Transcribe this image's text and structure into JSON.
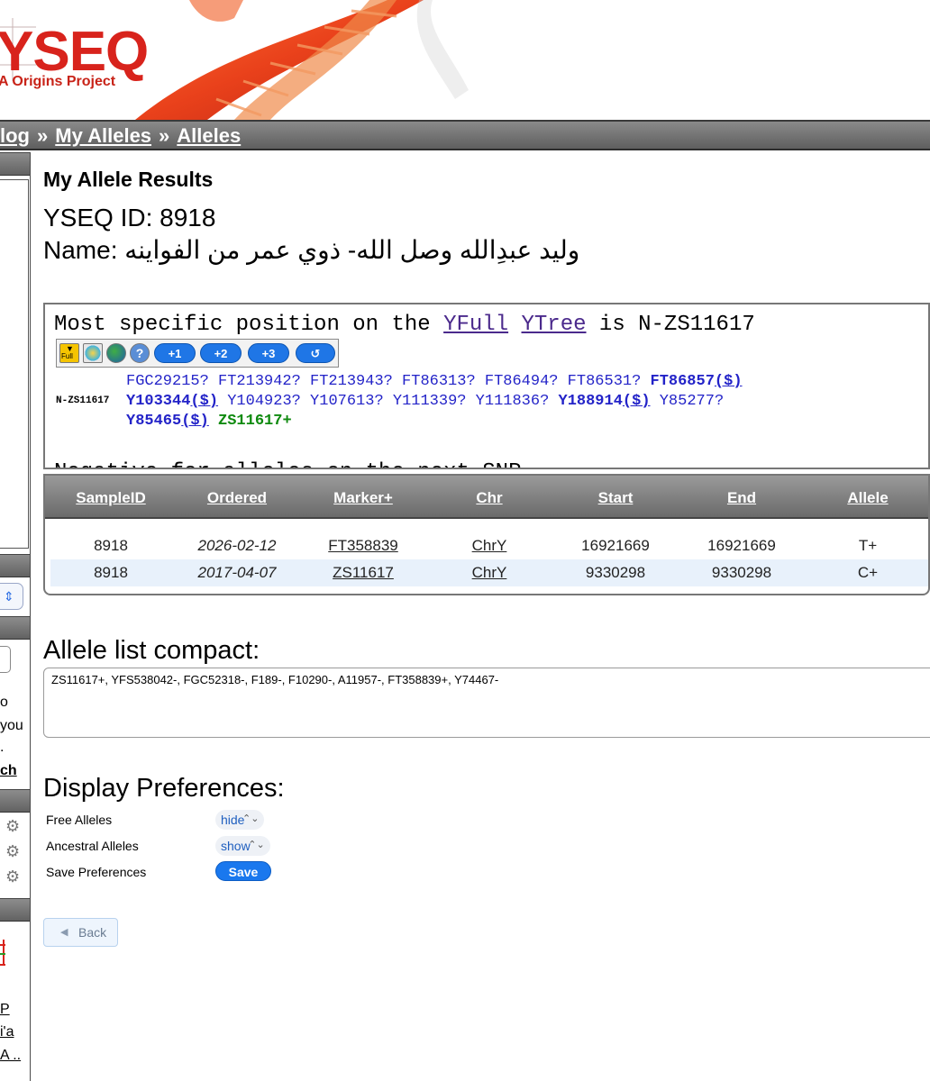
{
  "header": {
    "logo_text": "YSEQ",
    "logo_tagline": "A Origins Project"
  },
  "breadcrumb": {
    "items": [
      "log",
      "My Alleles",
      "Alleles"
    ],
    "separator": "»"
  },
  "sidebar": {
    "text_lines": [
      "o",
      "you",
      "."
    ],
    "link_search": "ch",
    "links_bottom": [
      "P",
      "i'a",
      "A .."
    ]
  },
  "main": {
    "heading": "My Allele Results",
    "ysid_label": "YSEQ ID: 8918",
    "name_label": "Name: ",
    "name_value": "وليد عبدِالله وصل الله- ذوي عمر من الفواينه"
  },
  "tree": {
    "title_prefix": "Most specific position on the ",
    "link_yfull": "YFull",
    "link_ytree": "YTree",
    "title_suffix": " is N-ZS11617",
    "toolbar": {
      "icon_names": [
        "yfull-icon",
        "palette-icon",
        "globe-icon",
        "help-icon"
      ],
      "yfull_icon_text": "Full",
      "pills": [
        "+1",
        "+2",
        "+3",
        "↺"
      ]
    },
    "node": "N-ZS11617",
    "line1": "FGC29215? FT213942? FT213943? FT86313? FT86494? FT86531? ",
    "line1_bold": "FT86857",
    "line1_bold_suffix": "($)",
    "line2_bold_a": "Y103344",
    "line2_bold_a_suffix": "($)",
    "line2_mid": " Y104923? Y107613? Y111339? Y111836? ",
    "line2_bold_b": "Y188914",
    "line2_bold_b_suffix": "($)",
    "line2_end": " Y85277?",
    "line3_bold": "Y85465",
    "line3_bold_suffix": "($)",
    "line3_green": " ZS11617+",
    "cut_text": "Negative for alleles on the next SNP"
  },
  "results": {
    "columns": [
      "SampleID",
      "Ordered",
      "Marker+",
      "Chr",
      "Start",
      "End",
      "Allele"
    ],
    "rows": [
      {
        "sample": "8918",
        "ordered": "2026-02-12",
        "marker": "FT358839",
        "chr": "ChrY",
        "start": "16921669",
        "end": "16921669",
        "allele": "T+"
      },
      {
        "sample": "8918",
        "ordered": "2017-04-07",
        "marker": "ZS11617",
        "chr": "ChrY",
        "start": "9330298",
        "end": "9330298",
        "allele": "C+"
      }
    ]
  },
  "compact": {
    "heading": "Allele list compact:",
    "value": "ZS11617+, YFS538042-, FGC52318-, F189-, F10290-, A11957-, FT358839+, Y74467-"
  },
  "prefs": {
    "heading": "Display Preferences:",
    "free_label": "Free Alleles",
    "free_value": "hide",
    "ancestral_label": "Ancestral Alleles",
    "ancestral_value": "show",
    "save_label": "Save Preferences",
    "save_button": "Save"
  },
  "back_button": "Back",
  "colors": {
    "brand_red": "#d8231c",
    "link_blue": "#2323c8",
    "positive_green": "#0f8a0f",
    "accent_blue": "#1a78ee"
  }
}
